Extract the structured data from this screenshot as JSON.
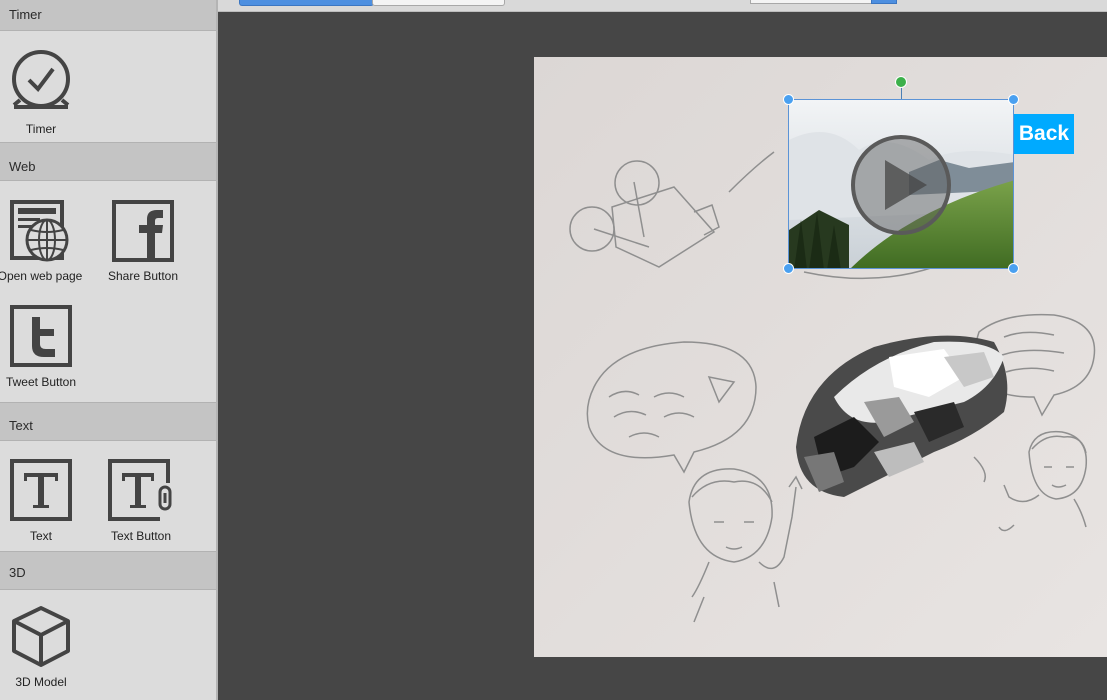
{
  "sidebar": {
    "sections": [
      {
        "title": "Timer",
        "tools": [
          {
            "label": "Timer",
            "icon": "timer-icon"
          }
        ]
      },
      {
        "title": "Web",
        "tools": [
          {
            "label": "Open web page",
            "icon": "globe-page-icon"
          },
          {
            "label": "Share Button",
            "icon": "facebook-icon"
          },
          {
            "label": "Tweet Button",
            "icon": "twitter-icon"
          }
        ]
      },
      {
        "title": "Text",
        "tools": [
          {
            "label": "Text",
            "icon": "text-icon"
          },
          {
            "label": "Text Button",
            "icon": "text-button-icon"
          }
        ]
      },
      {
        "title": "3D",
        "tools": [
          {
            "label": "3D Model",
            "icon": "cube-icon"
          }
        ]
      }
    ]
  },
  "canvas": {
    "back_button": {
      "label": "Back",
      "color": "#00aaff"
    },
    "video_element": {
      "icon": "play-icon"
    },
    "model_element": {
      "icon": "3d-model-preview"
    },
    "background": {
      "icon": "sketch-background"
    }
  },
  "colors": {
    "accent": "#4d8fe0",
    "selection_handle": "#4aa0f0",
    "rotate_handle": "#3cb04b"
  }
}
